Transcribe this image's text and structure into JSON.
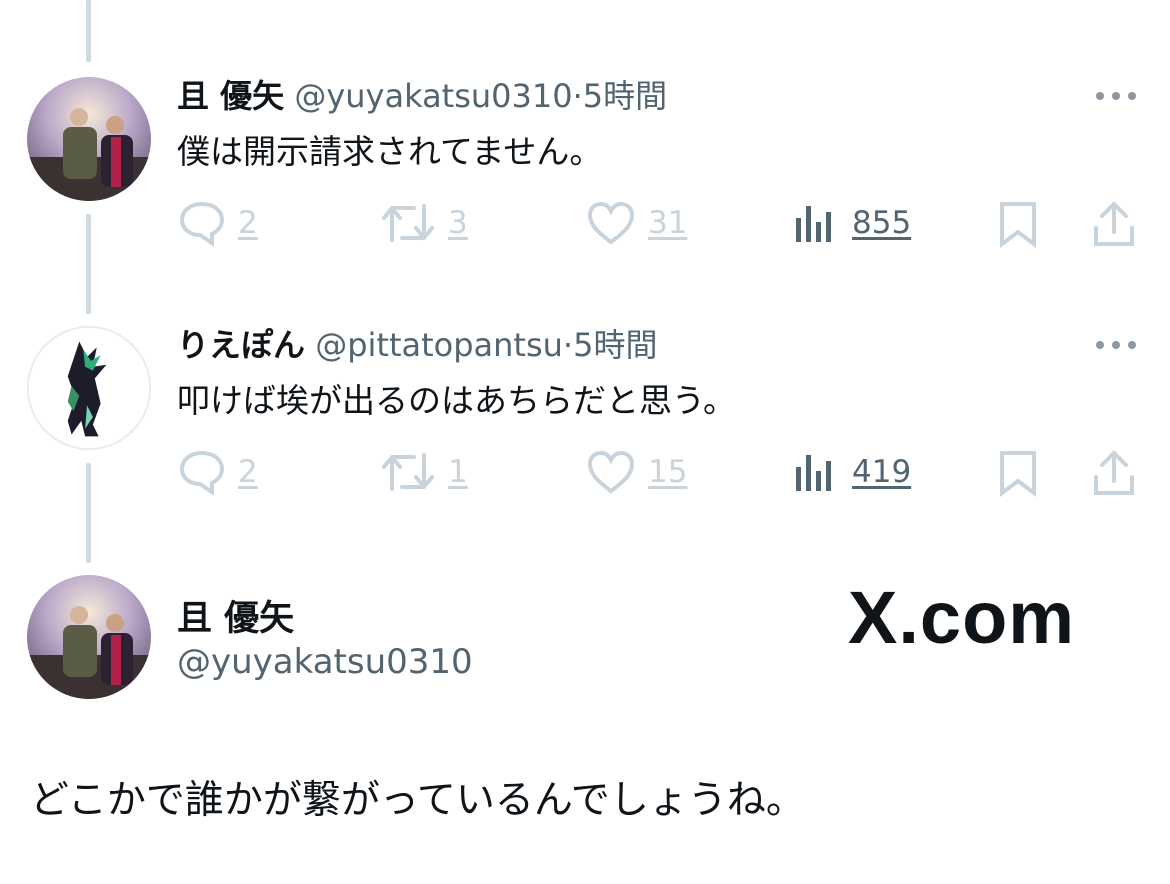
{
  "tweets": [
    {
      "name": "且 優矢",
      "handle": "@yuyakatsu0310",
      "separator": "·",
      "time": "5時間",
      "text": "僕は開示請求されてません。",
      "replies": "2",
      "retweets": "3",
      "likes": "31",
      "views": "855"
    },
    {
      "name": "りえぽん",
      "handle": "@pittatopantsu",
      "separator": "·",
      "time": "5時間",
      "text": "叩けば埃が出るのはあちらだと思う。",
      "replies": "2",
      "retweets": "1",
      "likes": "15",
      "views": "419"
    }
  ],
  "main_tweet": {
    "name": "且 優矢",
    "handle": "@yuyakatsu0310",
    "text": "どこかで誰かが繋がっているんでしょうね。"
  },
  "brand": "X.com",
  "icons": [
    "more-icon",
    "reply-icon",
    "retweet-icon",
    "like-icon",
    "views-icon",
    "bookmark-icon",
    "share-icon"
  ]
}
